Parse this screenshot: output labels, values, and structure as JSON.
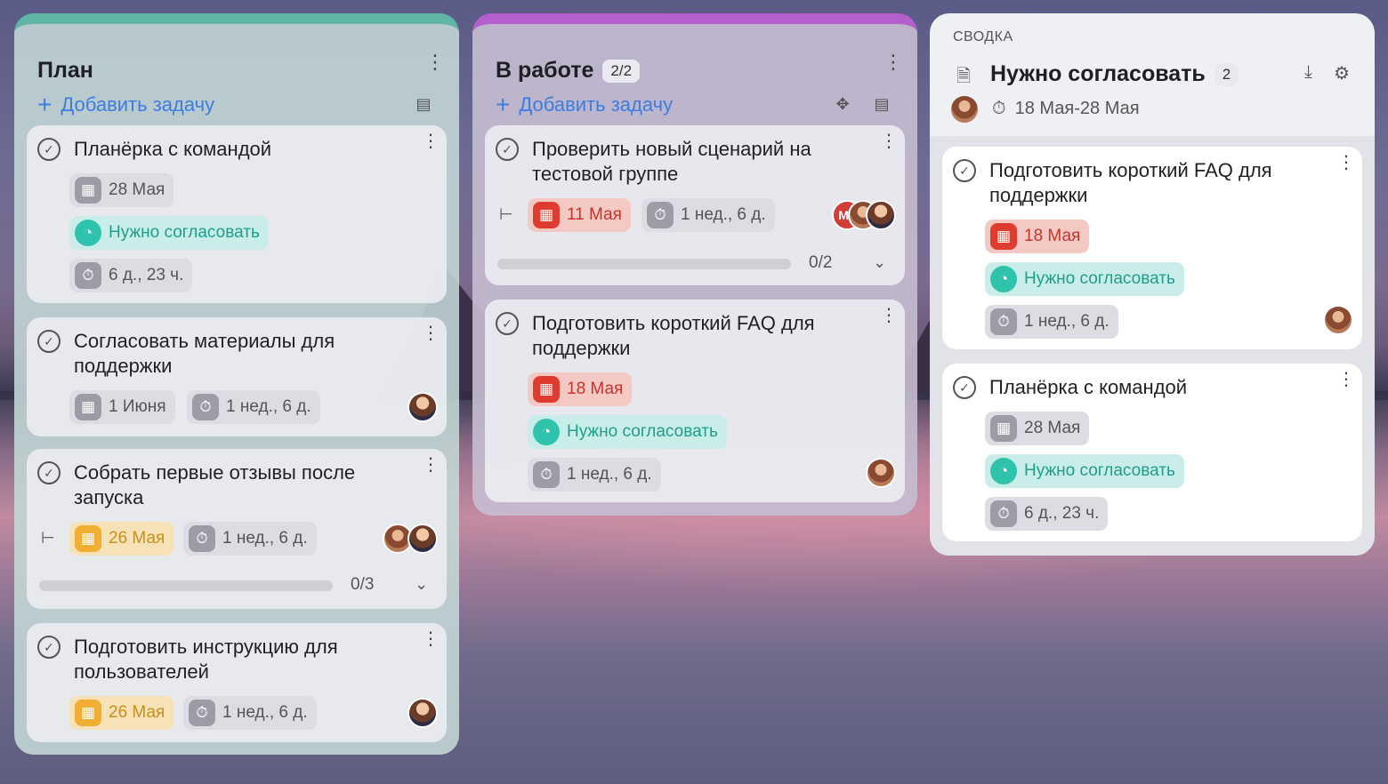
{
  "columns": {
    "plan": {
      "title": "План",
      "add_task": "Добавить задачу",
      "cards": [
        {
          "title": "Планёрка с командой",
          "date": "28 Мая",
          "status": "Нужно согласовать",
          "duration": "6 д., 23 ч."
        },
        {
          "title": "Согласовать материалы для поддержки",
          "date": "1 Июня",
          "duration": "1 нед., 6 д."
        },
        {
          "title": "Собрать первые отзывы после запуска",
          "date": "26 Мая",
          "duration": "1 нед., 6 д.",
          "progress": "0/3"
        },
        {
          "title": "Подготовить инструкцию для пользователей",
          "date": "26 Мая",
          "duration": "1 нед., 6 д."
        }
      ]
    },
    "work": {
      "title": "В работе",
      "count": "2/2",
      "add_task": "Добавить задачу",
      "cards": [
        {
          "title": "Проверить новый сценарий на тестовой группе",
          "date": "11 Мая",
          "duration": "1 нед., 6 д.",
          "progress": "0/2",
          "avatar_initials": "МГ"
        },
        {
          "title": "Подготовить короткий FAQ для поддержки",
          "date": "18 Мая",
          "status": "Нужно согласовать",
          "duration": "1 нед., 6 д."
        }
      ]
    },
    "summary": {
      "label": "СВОДКА",
      "title": "Нужно согласовать",
      "count": "2",
      "range": "18 Мая-28 Мая",
      "cards": [
        {
          "title": "Подготовить короткий FAQ для поддержки",
          "date": "18 Мая",
          "status": "Нужно согласовать",
          "duration": "1 нед., 6 д."
        },
        {
          "title": "Планёрка с командой",
          "date": "28 Мая",
          "status": "Нужно согласовать",
          "duration": "6 д., 23 ч."
        }
      ]
    }
  },
  "colors": {
    "plan_accent": "#5fb6a6",
    "work_accent": "#b55fcf",
    "link_blue": "#3d7de0",
    "overdue_red": "#df3b2e",
    "due_yellow": "#f0ae33",
    "status_green": "#2fc3ad"
  },
  "icons": [
    "check-circle-icon",
    "calendar-icon",
    "status-pie-icon",
    "timer-icon",
    "more-vertical-icon",
    "plus-icon",
    "card-layout-icon",
    "puzzle-icon",
    "subtasks-icon",
    "chevron-down-icon",
    "document-icon",
    "download-icon",
    "gear-icon"
  ]
}
